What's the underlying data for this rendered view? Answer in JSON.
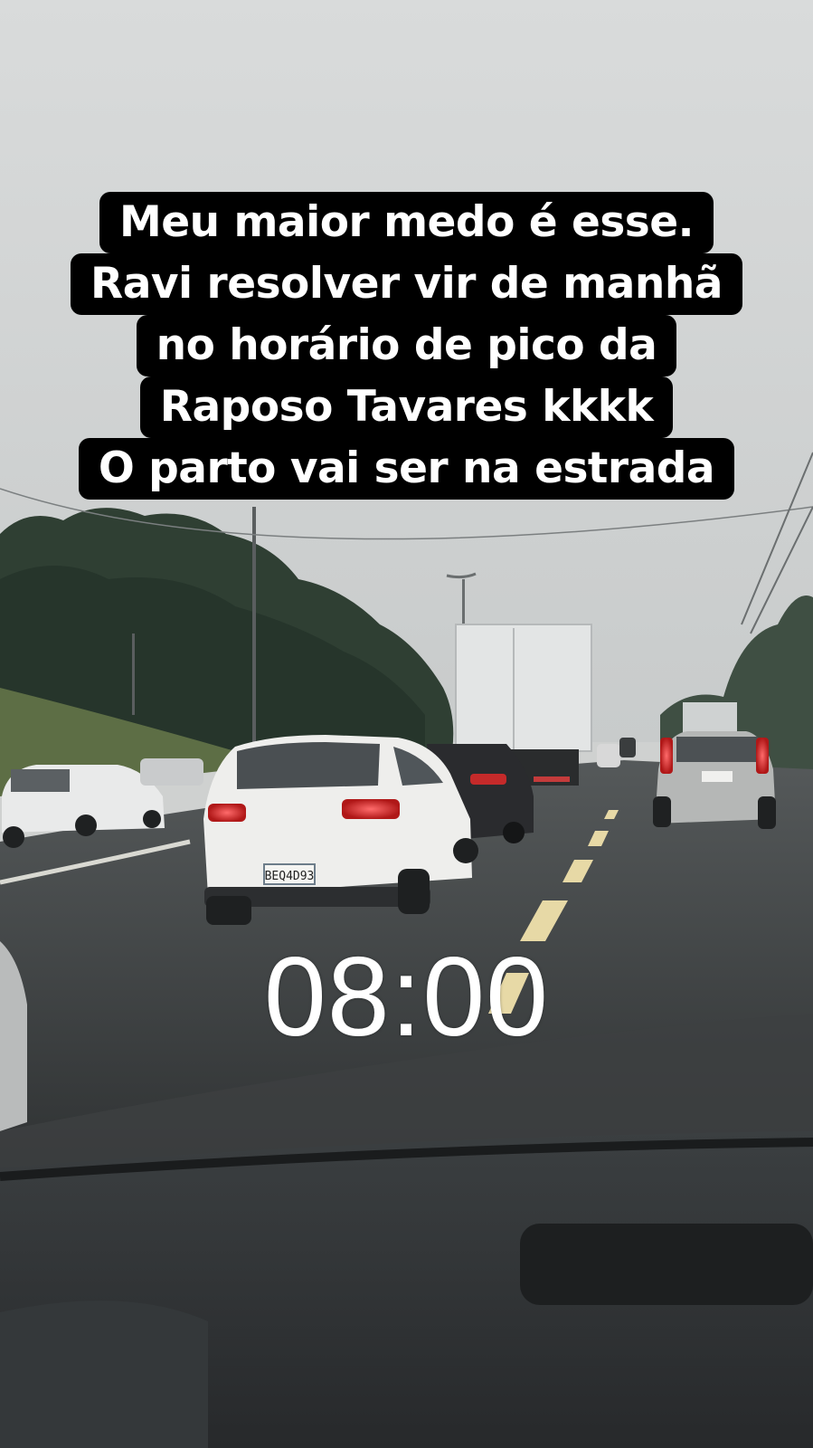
{
  "story": {
    "caption_lines": [
      "Meu maior medo é esse.",
      "Ravi resolver vir de manhã",
      "no horário de pico da",
      "Raposo Tavares kkkk",
      "O parto vai ser na estrada"
    ],
    "time_sticker": "08:00",
    "license_plate": "BEQ4D93"
  },
  "colors": {
    "caption_background": "#000000",
    "caption_text": "#ffffff",
    "time_sticker_text": "#ffffff",
    "sky": "#d6d8d8",
    "road": "#3a3d3e",
    "dashboard": "#2c2f31"
  }
}
